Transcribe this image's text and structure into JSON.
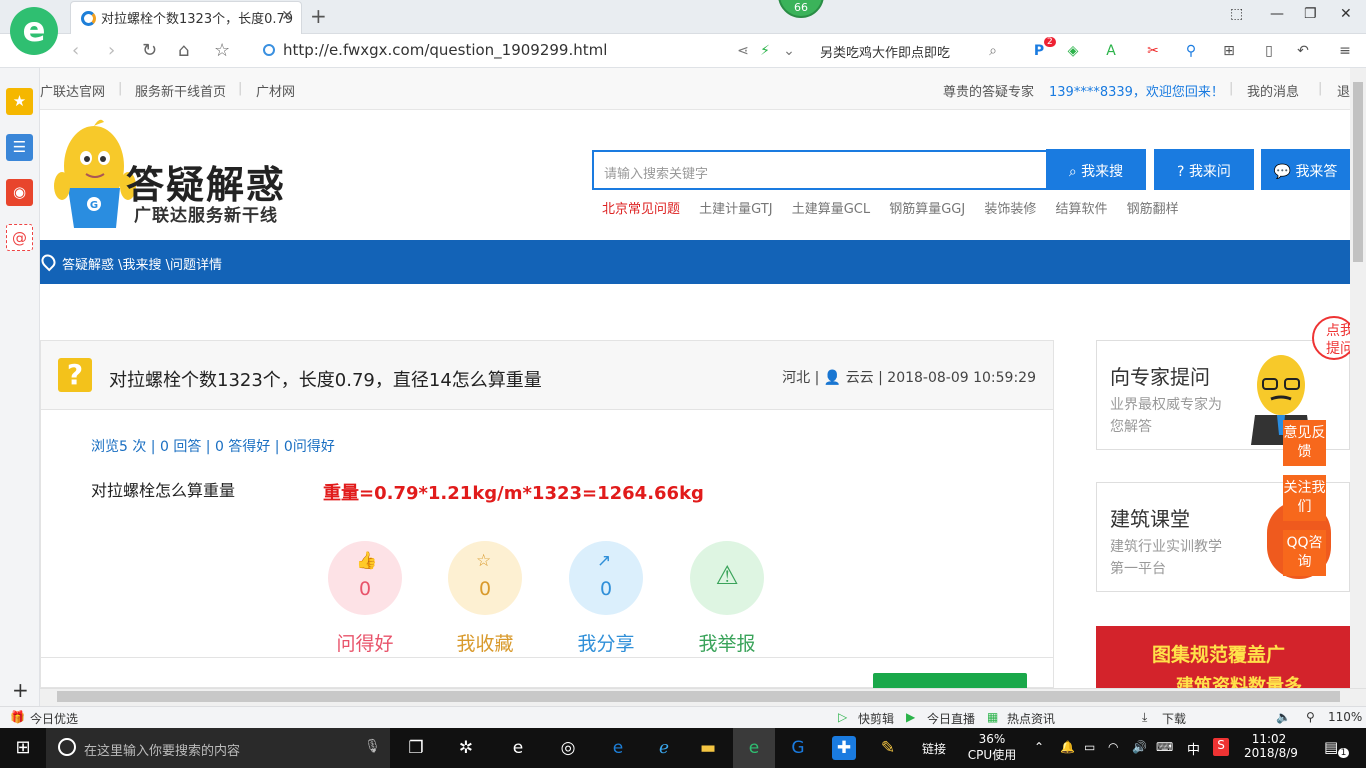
{
  "browser": {
    "tab_title": "对拉螺栓个数1323个，长度0.79",
    "badge_count": "66",
    "url": "http://e.fwxgx.com/question_1909299.html",
    "promo_text": "另类吃鸡大作即点即吃",
    "ext_badge": "2"
  },
  "site": {
    "top_links": [
      "广联达官网",
      "服务新干线首页",
      "广材网"
    ],
    "greeting": "尊贵的答疑专家",
    "user": "139****8339，欢迎您回来！",
    "messages": "我的消息",
    "logout": "退",
    "brand_title": "答疑解惑",
    "brand_subtitle": "广联达服务新干线",
    "search_placeholder": "请输入搜索关键字",
    "btn_search": "我来搜",
    "btn_ask": "我来问",
    "btn_answer": "我来答",
    "hot_links": [
      "北京常见问题",
      "土建计量GTJ",
      "土建算量GCL",
      "钢筋算量GGJ",
      "装饰装修",
      "结算软件",
      "钢筋翻样"
    ],
    "breadcrumb": "答疑解惑 \\我来搜 \\问题详情"
  },
  "question": {
    "icon": "?",
    "title": "对拉螺栓个数1323个，长度0.79，直径14怎么算重量",
    "meta_region": "河北 |",
    "meta_user": "云云",
    "meta_time": "| 2018-08-09 10:59:29",
    "stats": "浏览5 次 | 0 回答 | 0 答得好 | 0问得好",
    "body": "对拉螺栓怎么算重量",
    "answer_text": "重量=0.79*1.21kg/m*1323=1264.66kg",
    "actions": [
      {
        "label": "问得好",
        "count": "0",
        "icon": "thumbs-up",
        "color": "#e8536a",
        "bg": "#fde2e6"
      },
      {
        "label": "我收藏",
        "count": "0",
        "icon": "star",
        "color": "#d99a2c",
        "bg": "#fdf0d2"
      },
      {
        "label": "我分享",
        "count": "0",
        "icon": "share",
        "color": "#2f8fd8",
        "bg": "#dbeffc"
      },
      {
        "label": "我举报",
        "count": "",
        "icon": "warning",
        "color": "#3aa35a",
        "bg": "#def5e2"
      }
    ]
  },
  "sidebar": {
    "expert_title": "向专家提问",
    "expert_sub": "业界最权威专家为您解答",
    "class_title": "建筑课堂",
    "class_sub": "建筑行业实训教学第一平台",
    "banner_line1": "图集规范覆盖广",
    "banner_line2": "建筑资料数量多",
    "float_buttons": [
      "意见反馈",
      "关注我们",
      "QQ咨询"
    ],
    "corner_text": "点我提问"
  },
  "statusbar": {
    "left": "今日优选",
    "items": [
      "快剪辑",
      "今日直播",
      "热点资讯",
      "下载"
    ],
    "zoom": "110%"
  },
  "taskbar": {
    "search_placeholder": "在这里输入你要搜索的内容",
    "links_label": "链接",
    "cpu_percent": "36%",
    "cpu_label": "CPU使用",
    "ime": "中",
    "time": "11:02",
    "date": "2018/8/9",
    "notif_count": "1"
  }
}
